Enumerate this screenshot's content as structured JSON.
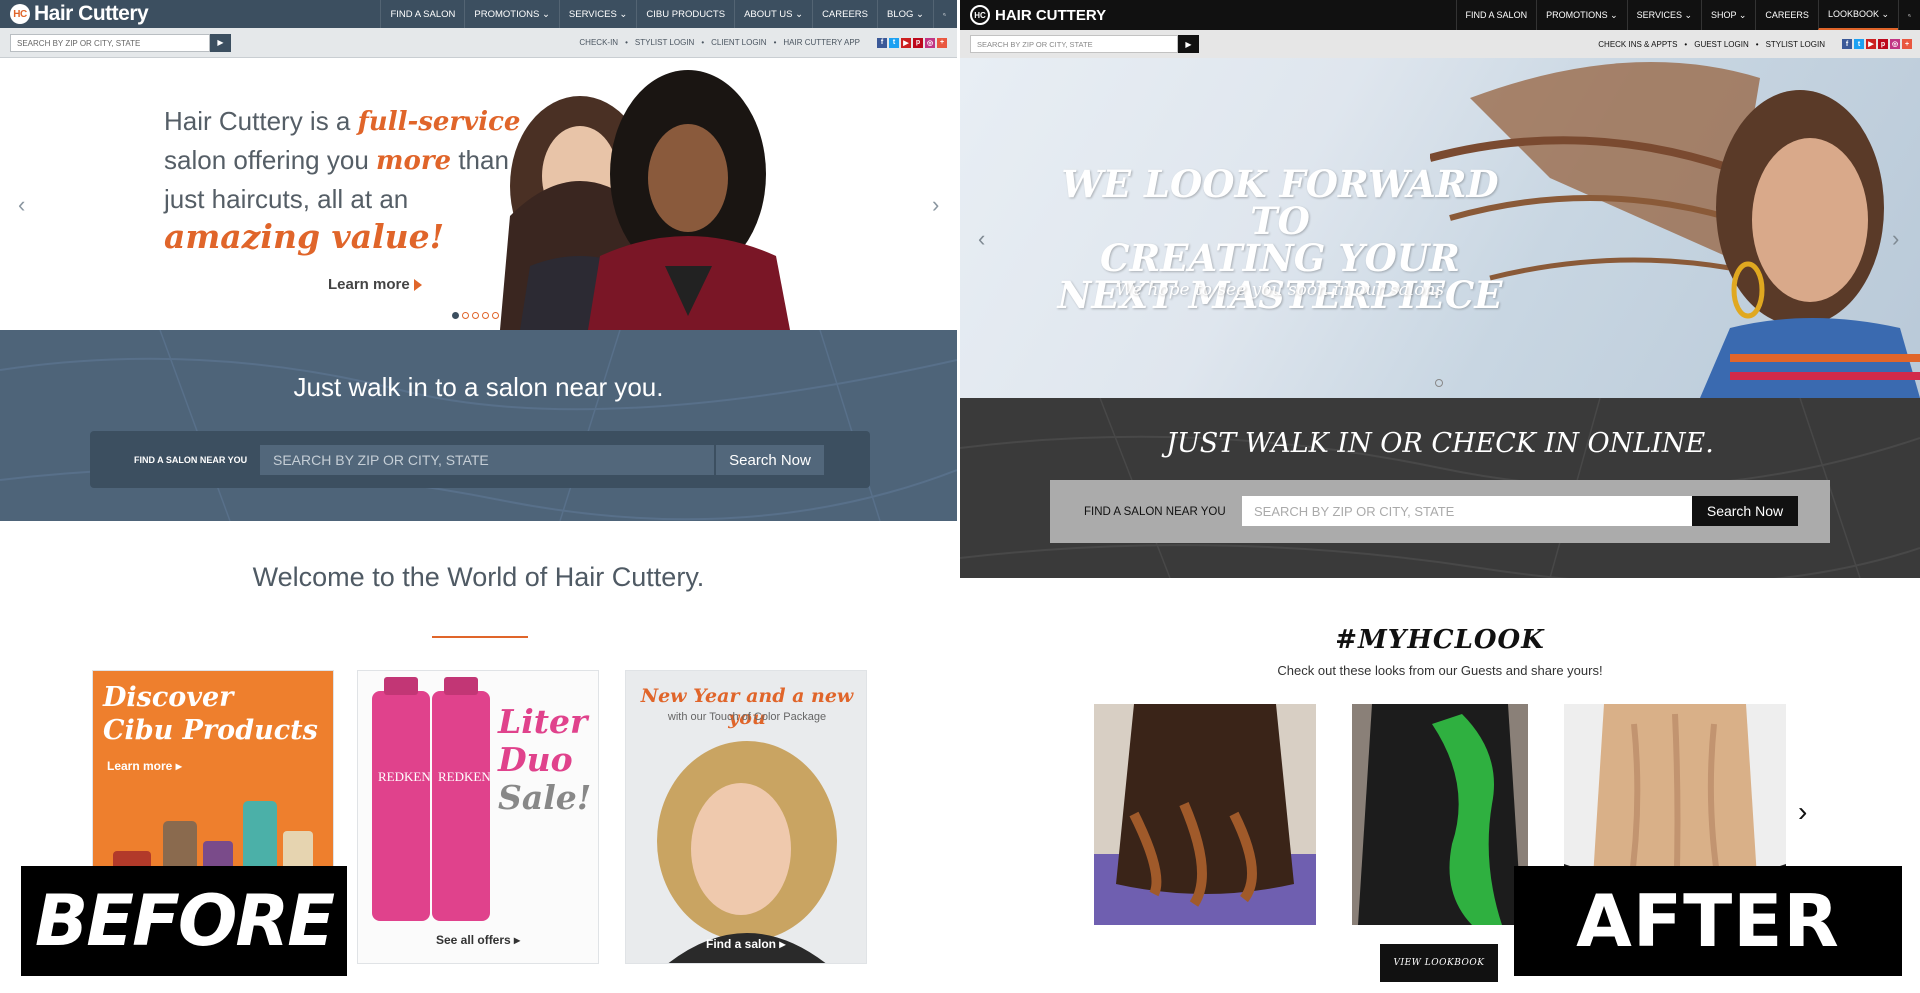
{
  "before": {
    "logo_text": "Hair Cuttery",
    "logo_mark": "HC",
    "nav": [
      "FIND A SALON",
      "PROMOTIONS ⌄",
      "SERVICES ⌄",
      "CIBU PRODUCTS",
      "ABOUT US ⌄",
      "CAREERS",
      "BLOG ⌄"
    ],
    "search_placeholder": "SEARCH BY ZIP OR CITY, STATE",
    "util_links": [
      "CHECK-IN",
      "STYLIST LOGIN",
      "CLIENT LOGIN",
      "HAIR CUTTERY APP"
    ],
    "util_sep": "•",
    "hero": {
      "line1a": "Hair Cuttery is a ",
      "line1b": "full-service",
      "line2a": "salon offering you ",
      "line2b": "more",
      "line2c": " than",
      "line3": "just haircuts, all at an",
      "line4": "amazing value!",
      "learn_more": "Learn more"
    },
    "band": {
      "title": "Just walk in to a salon near you.",
      "label": "FIND A SALON NEAR YOU",
      "placeholder": "SEARCH BY ZIP OR CITY, STATE",
      "button": "Search Now"
    },
    "welcome": "Welcome to the World of Hair Cuttery.",
    "cards": {
      "c1_title": "Discover\nCibu Products",
      "c1_learn": "Learn more ▸",
      "c2_line1": "Liter",
      "c2_line2": "Duo",
      "c2_line3": "Sale!",
      "c2_link": "See all offers ▸",
      "c3_head": "New Year and a new you",
      "c3_sub": "with our Touch of Color Package",
      "c3_link": "Find a salon ▸"
    },
    "badge": "BEFORE"
  },
  "after": {
    "logo_text": "HAIR CUTTERY",
    "logo_mark": "HC",
    "nav": [
      "FIND A SALON",
      "PROMOTIONS ⌄",
      "SERVICES ⌄",
      "SHOP ⌄",
      "CAREERS",
      "LOOKBOOK ⌄"
    ],
    "search_placeholder": "SEARCH BY ZIP OR CITY, STATE",
    "util_links": [
      "CHECK INS & APPTS",
      "•",
      "GUEST LOGIN",
      "•",
      "STYLIST LOGIN"
    ],
    "hero": {
      "title_line1": "WE LOOK FORWARD TO",
      "title_line2": "CREATING YOUR",
      "title_line3": "NEXT MASTERPIECE",
      "subtitle": "We hope to see you soon in our salons"
    },
    "band": {
      "title": "JUST WALK IN OR CHECK IN ONLINE.",
      "label": "FIND A SALON NEAR YOU",
      "placeholder": "SEARCH BY ZIP OR CITY, STATE",
      "button": "Search Now"
    },
    "lookbook": {
      "title": "#MYHCLOOK",
      "subtitle": "Check out these looks from our Guests and share yours!",
      "button": "VIEW LOOKBOOK"
    },
    "badge": "AFTER"
  },
  "colors": {
    "before_nav": "#3c4f60",
    "before_accent": "#e0652a",
    "after_nav": "#111111",
    "after_band": "#3a3a3a"
  },
  "icons": {
    "search": "search-icon",
    "chevron_left": "chevron-left-icon",
    "chevron_right": "chevron-right-icon",
    "play": "play-icon",
    "social": [
      "facebook-icon",
      "twitter-icon",
      "youtube-icon",
      "pinterest-icon",
      "instagram-icon",
      "google-plus-icon"
    ]
  }
}
